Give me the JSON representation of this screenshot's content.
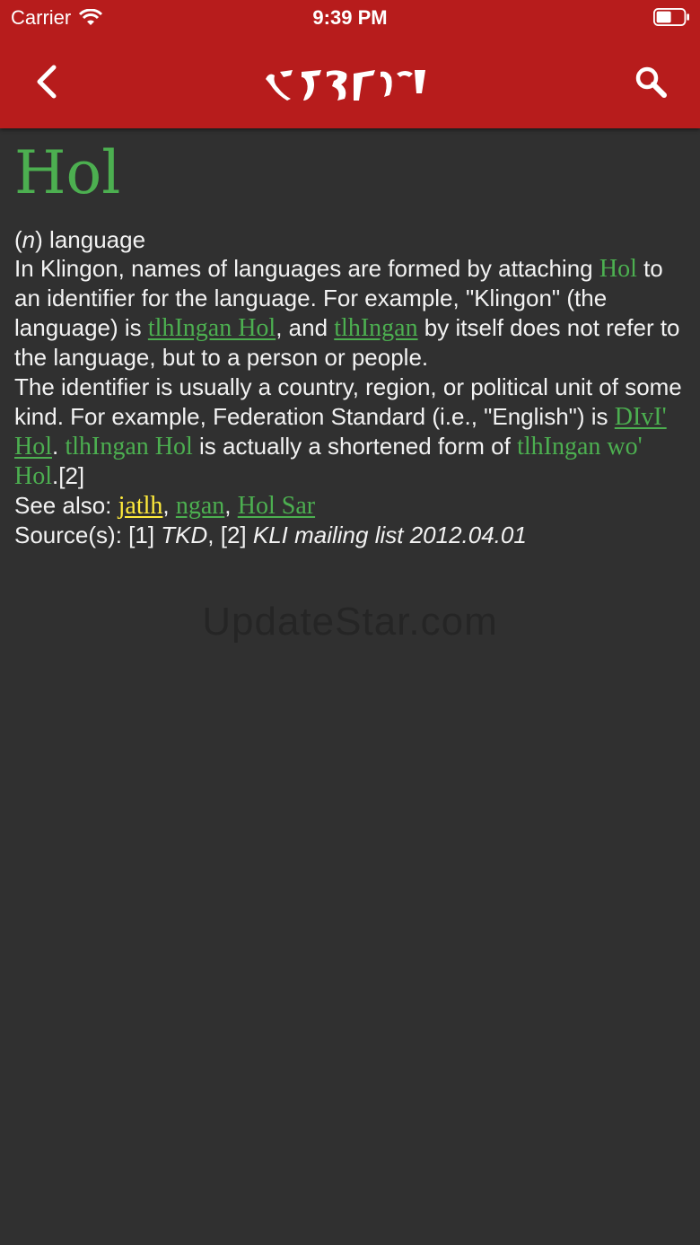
{
  "status_bar": {
    "carrier": "Carrier",
    "time": "9:39 PM",
    "battery_level": 0.55
  },
  "nav": {
    "back_icon": "chevron-left-icon",
    "logo_icon": "klingon-script-logo",
    "search_icon": "search-icon"
  },
  "entry": {
    "title": "Hol",
    "pos_open": "(",
    "pos": "n",
    "pos_close": ")",
    "definition": " language",
    "p1": {
      "t1": "In Klingon, names of languages are formed by attaching ",
      "k1": "Hol",
      "t2": " to an identifier for the language. For example, \"Klingon\" (the language) is ",
      "k2": "tlhIngan Hol",
      "t3": ", and ",
      "k3": "tlhIngan",
      "t4": " by itself does not refer to the language, but to a person or people."
    },
    "p2": {
      "t1": "The identifier is usually a country, region, or political unit of some kind. For example, Federation Standard (i.e., \"English\") is ",
      "k1": "DIvI' Hol",
      "t2": ". ",
      "k2": "tlhIngan Hol",
      "t3": " is actually a shortened form of ",
      "k3": "tlhIngan wo' Hol",
      "t4": ".[2]"
    },
    "see_also": {
      "label": "See also: ",
      "link1": "jatlh",
      "sep1": ", ",
      "link2": "ngan",
      "sep2": ", ",
      "link3": "Hol Sar"
    },
    "sources": {
      "label": "Source(s): [1] ",
      "s1": "TKD",
      "sep": ", [2] ",
      "s2": "KLI mailing list 2012.04.01"
    }
  },
  "watermark": "UpdateStar.com",
  "colors": {
    "header": "#b71c1c",
    "background": "#303030",
    "klingon_green": "#4caf50",
    "link_yellow": "#ffeb3b",
    "text": "#f2f2f2"
  }
}
